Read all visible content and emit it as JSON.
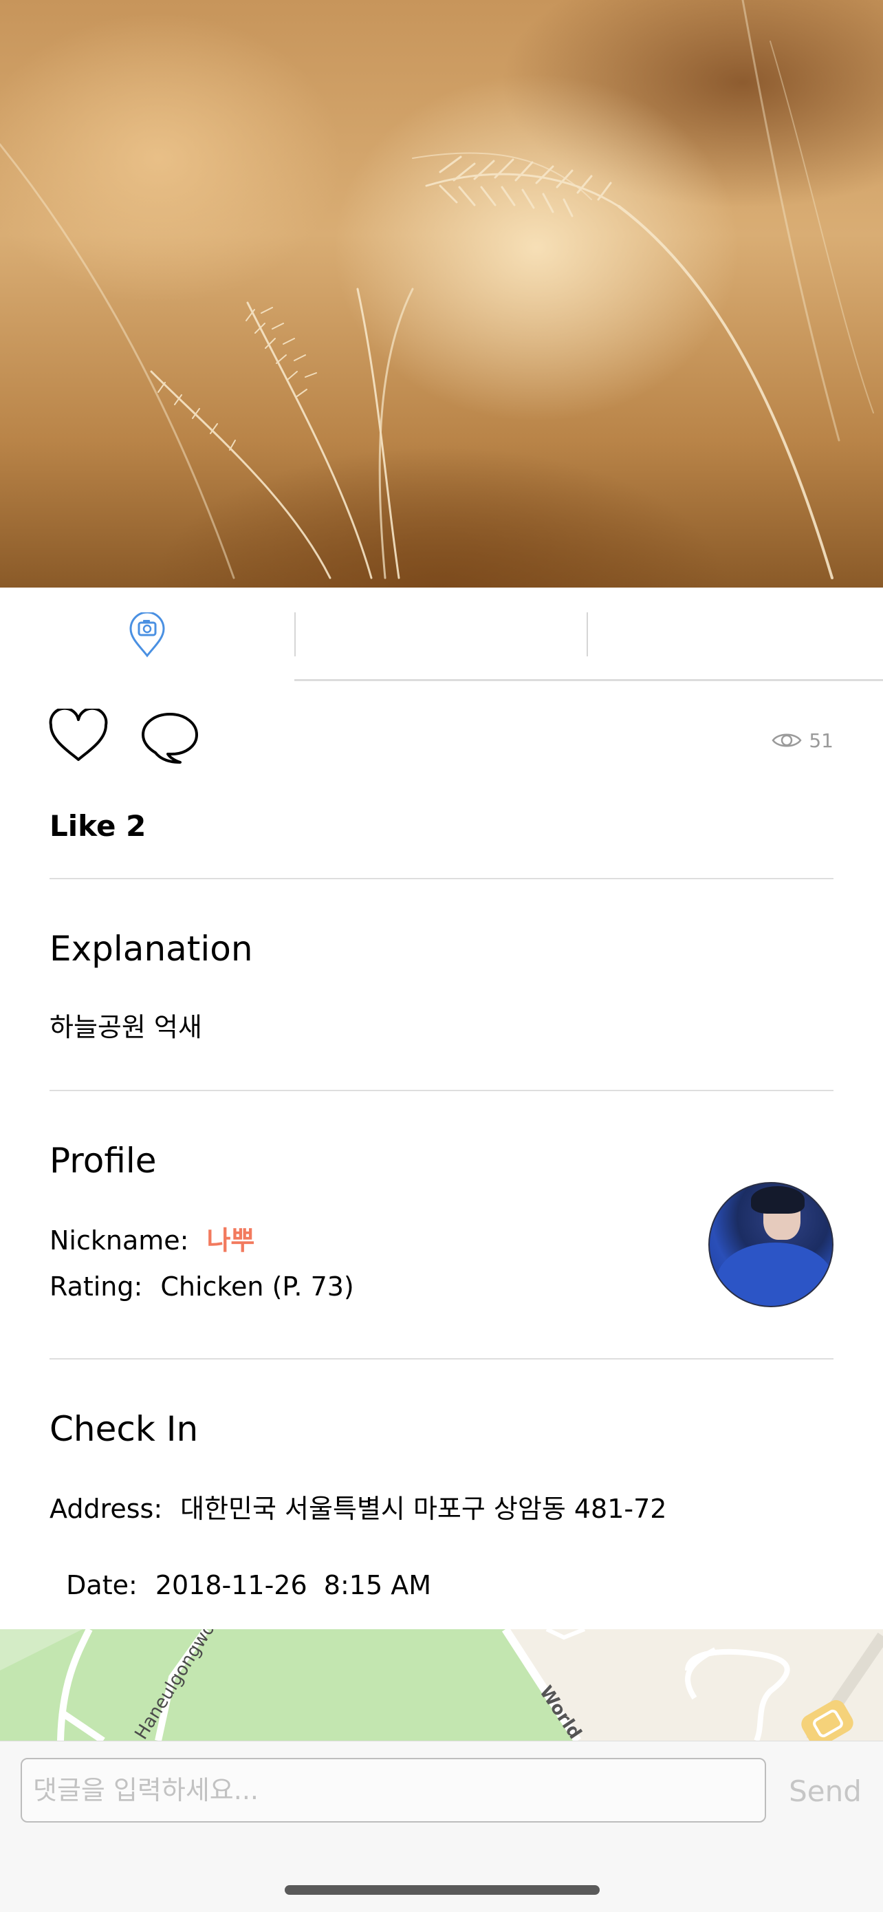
{
  "hero": {
    "image_description_icon": "pampas-grass-photo"
  },
  "tabs": [
    {
      "icon": "map-pin-camera-icon",
      "selected": true
    },
    {
      "icon": "",
      "selected": false
    },
    {
      "icon": "",
      "selected": false
    }
  ],
  "colors": {
    "accent": "#4a90e2",
    "nickname": "#f27a5e",
    "muted": "#9a9a9a",
    "divider": "#dedede"
  },
  "actions": {
    "heart_icon": "heart-icon",
    "comment_icon": "speech-bubble-icon",
    "views_icon": "eye-icon",
    "views_count": "51"
  },
  "likes": {
    "text": "Like 2"
  },
  "explanation": {
    "title": "Explanation",
    "text": "하늘공원 억새"
  },
  "profile": {
    "title": "Profile",
    "nickname_label": "Nickname:",
    "nickname_value": "나뿌",
    "rating_label": "Rating:",
    "rating_value": "Chicken (P. 73)"
  },
  "checkin": {
    "title": "Check In",
    "address_label": "Address:",
    "address_value": "대한민국 서울특별시 마포구 상암동 481-72",
    "date_label": "Date:",
    "date_value": "2018-11-26  8:15 AM"
  },
  "map": {
    "road_label_1": "Haneulgongwon-ro",
    "road_label_2": "World"
  },
  "composer": {
    "placeholder": "댓글을 입력하세요...",
    "send_label": "Send"
  }
}
